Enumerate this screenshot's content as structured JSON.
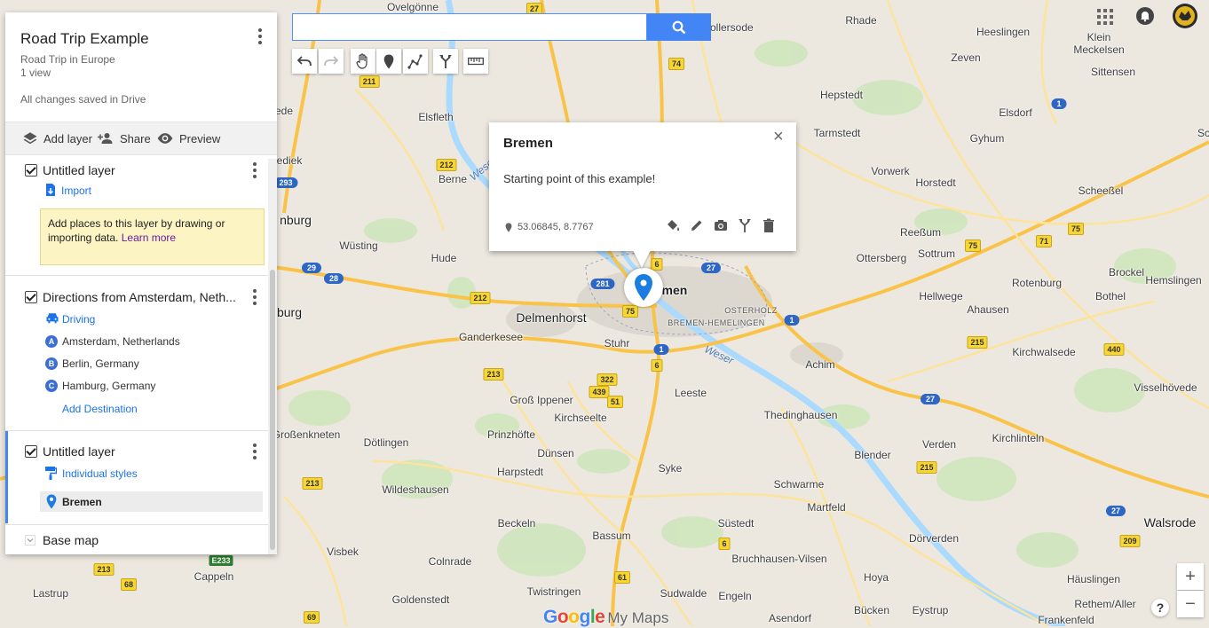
{
  "map": {
    "places": [
      {
        "name": "Ovelgönne"
      },
      {
        "name": "Hollersode"
      },
      {
        "name": "Rhade"
      },
      {
        "name": "Heeslingen"
      },
      {
        "name": "Klein\nMeckelsen"
      },
      {
        "name": "Zeven"
      },
      {
        "name": "Elsfleth"
      },
      {
        "name": "Hepstedt"
      },
      {
        "name": "Elsdorf"
      },
      {
        "name": "Gyhum"
      },
      {
        "name": "Tarmstedt"
      },
      {
        "name": "Sittensen"
      },
      {
        "name": "Vorwerk"
      },
      {
        "name": "Horstedt"
      },
      {
        "name": "Scheeßel"
      },
      {
        "name": "Berne"
      },
      {
        "name": "Reeßum"
      },
      {
        "name": "Sottrum"
      },
      {
        "name": "Ottersberg"
      },
      {
        "name": "Brockel"
      },
      {
        "name": "Hemslingen"
      },
      {
        "name": "Rotenburg"
      },
      {
        "name": "Bothel"
      },
      {
        "name": "Wüsting"
      },
      {
        "name": "Hude"
      },
      {
        "name": "Hellwege"
      },
      {
        "name": "Ahausen"
      },
      {
        "name": "Ganderkesee"
      },
      {
        "name": "Stuhr"
      },
      {
        "name": "Kirchwalsede"
      },
      {
        "name": "Achim"
      },
      {
        "name": "Leeste"
      },
      {
        "name": "Groß Ippener"
      },
      {
        "name": "Kirchseelte"
      },
      {
        "name": "Thedinghausen"
      },
      {
        "name": "Visselhövede"
      },
      {
        "name": "Prinzhöfte"
      },
      {
        "name": "Verden"
      },
      {
        "name": "Kirchlinteln"
      },
      {
        "name": "Dötlingen"
      },
      {
        "name": "Dünsen"
      },
      {
        "name": "Blender"
      },
      {
        "name": "Harpstedt"
      },
      {
        "name": "Syke"
      },
      {
        "name": "Wildeshausen"
      },
      {
        "name": "Schwarme"
      },
      {
        "name": "Martfeld"
      },
      {
        "name": "Beckeln"
      },
      {
        "name": "Süstedt"
      },
      {
        "name": "Walsrode"
      },
      {
        "name": "Bassum"
      },
      {
        "name": "Visbek"
      },
      {
        "name": "Colnrade"
      },
      {
        "name": "Bruchhausen-Vilsen"
      },
      {
        "name": "Dörverden"
      },
      {
        "name": "Cappeln"
      },
      {
        "name": "Hoya"
      },
      {
        "name": "Häuslingen"
      },
      {
        "name": "Lastrup"
      },
      {
        "name": "Twistringen"
      },
      {
        "name": "Sudwalde"
      },
      {
        "name": "Engeln"
      },
      {
        "name": "Goldenstedt"
      },
      {
        "name": "Asendorf"
      },
      {
        "name": "Bücken"
      },
      {
        "name": "Eystrup"
      },
      {
        "name": "Rethem/Aller"
      },
      {
        "name": "Frankenfeld"
      },
      {
        "name": "Großenkneten"
      },
      {
        "name": "nburg"
      },
      {
        "name": "burg"
      },
      {
        "name": "ede"
      },
      {
        "name": "ediek"
      },
      {
        "name": "Sc"
      }
    ],
    "cities": [
      {
        "name": "Delmenhorst"
      },
      {
        "name": "emen"
      }
    ],
    "districts": [
      {
        "name": "OSTERHOLZ"
      },
      {
        "name": "BREMEN-HEMELINGEN"
      }
    ],
    "rivers": [
      {
        "name": "Weser"
      },
      {
        "name": "Weser"
      }
    ],
    "shields": [
      "27",
      "74",
      "211",
      "212",
      "293",
      "29",
      "28",
      "212",
      "281",
      "6",
      "27",
      "75",
      "1",
      "75",
      "71",
      "75",
      "1",
      "212",
      "6",
      "1",
      "215",
      "440",
      "213",
      "322",
      "439",
      "51",
      "27",
      "213",
      "215",
      "27",
      "209",
      "6",
      "61",
      "68",
      "213",
      "69",
      "E233",
      "1"
    ],
    "logo_google": "Google",
    "logo_mymaps": "My Maps"
  },
  "panel": {
    "title": "Road Trip Example",
    "description": "Road Trip in Europe",
    "views": "1 view",
    "save_status": "All changes saved in Drive",
    "actions": {
      "add_layer": "Add layer",
      "share": "Share",
      "preview": "Preview"
    },
    "layer1": {
      "name": "Untitled layer",
      "import": "Import",
      "hint": "Add places to this layer by drawing or importing data.",
      "learn_more": "Learn more"
    },
    "layer2": {
      "name": "Directions from Amsterdam, Neth...",
      "mode": "Driving",
      "stops": [
        {
          "letter": "A",
          "place": "Amsterdam, Netherlands"
        },
        {
          "letter": "B",
          "place": "Berlin, Germany"
        },
        {
          "letter": "C",
          "place": "Hamburg, Germany"
        }
      ],
      "add_destination": "Add Destination"
    },
    "layer3": {
      "name": "Untitled layer",
      "style": "Individual styles",
      "item": "Bremen"
    },
    "basemap": "Base map"
  },
  "search": {
    "placeholder": "",
    "value": ""
  },
  "info": {
    "title": "Bremen",
    "description": "Starting point of this example!",
    "coords": "53.06845, 8.7767",
    "close": "×"
  },
  "zoom": {
    "in": "+",
    "out": "−"
  },
  "help": "?",
  "colors": {
    "accent": "#4385f4",
    "link": "#1a73e8",
    "hint_bg": "#fdf4c4",
    "marker": "#1c7de0"
  }
}
